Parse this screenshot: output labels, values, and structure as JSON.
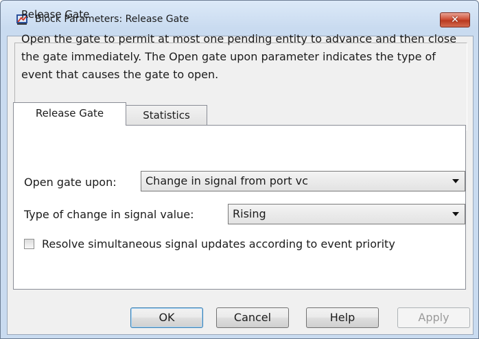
{
  "window": {
    "title": "Block Parameters: Release Gate",
    "close_symbol": "✕"
  },
  "description": {
    "title": "Release Gate",
    "text": "Open the gate to permit at most one pending entity to advance and then close the gate immediately. The Open gate upon parameter indicates the type of event that causes the gate to open."
  },
  "tabs": [
    {
      "label": "Release Gate",
      "active": true
    },
    {
      "label": "Statistics",
      "active": false
    }
  ],
  "params": {
    "open_gate_label": "Open gate upon:",
    "open_gate_value": "Change in signal from port vc",
    "change_type_label": "Type of change in signal value:",
    "change_type_value": "Rising",
    "resolve_label": "Resolve simultaneous signal updates according to event priority",
    "resolve_checked": false
  },
  "buttons": {
    "ok": "OK",
    "cancel": "Cancel",
    "help": "Help",
    "apply": "Apply"
  },
  "icons": {
    "app": "simulink-block-icon",
    "close": "close-icon",
    "dropdown": "chevron-down-icon"
  },
  "colors": {
    "title_bar": "#c9dbf0",
    "close_button": "#cf5138",
    "default_button_border": "#3c7fb1"
  }
}
